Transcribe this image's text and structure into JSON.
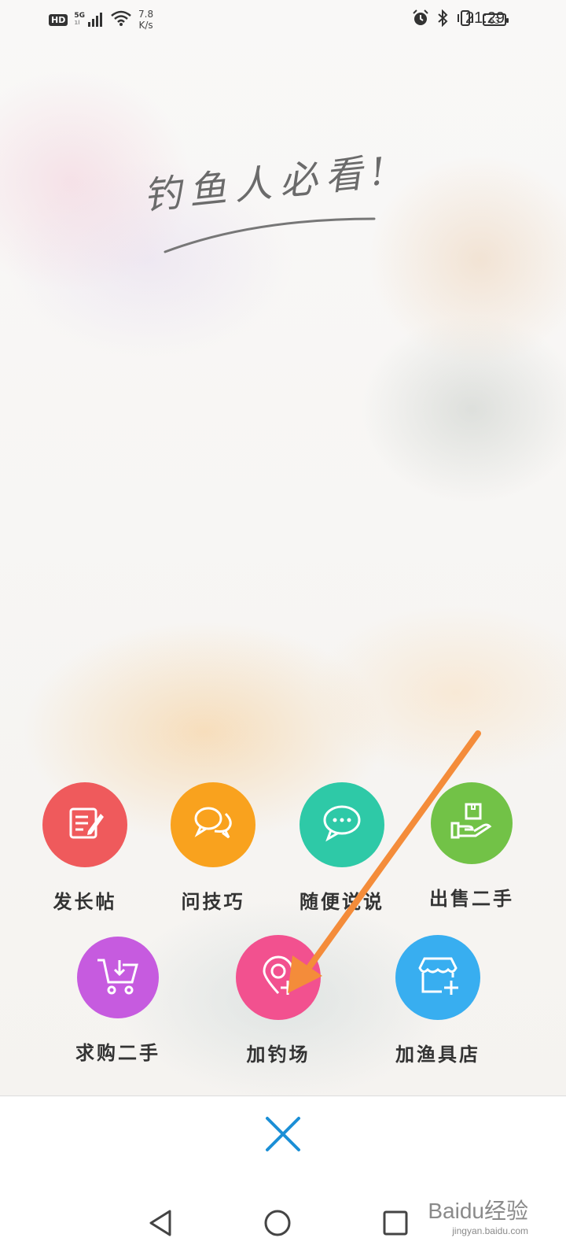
{
  "status_bar": {
    "hd": "HD",
    "network": "5G",
    "network_sub": "1l",
    "speed_value": "7.8",
    "speed_unit": "K/s",
    "battery": "63",
    "time": "21:29"
  },
  "slogan": "钓鱼人必看!",
  "actions_row1": [
    {
      "label": "发长帖",
      "color": "#ef5a5c",
      "icon": "edit-note-icon"
    },
    {
      "label": "问技巧",
      "color": "#f9a21e",
      "icon": "chat-bubbles-icon"
    },
    {
      "label": "随便说说",
      "color": "#2ec9a7",
      "icon": "chat-dots-icon"
    },
    {
      "label": "出售二手",
      "color": "#72c247",
      "icon": "hand-box-icon"
    }
  ],
  "actions_row2": [
    {
      "label": "求购二手",
      "color": "#c65bdf",
      "icon": "cart-download-icon"
    },
    {
      "label": "加钓场",
      "color": "#f2518f",
      "icon": "location-add-icon"
    },
    {
      "label": "加渔具店",
      "color": "#38aef0",
      "icon": "store-add-icon"
    }
  ],
  "close": {
    "icon": "close-icon"
  },
  "watermark": {
    "brand": "Baidu经验",
    "url": "jingyan.baidu.com"
  }
}
